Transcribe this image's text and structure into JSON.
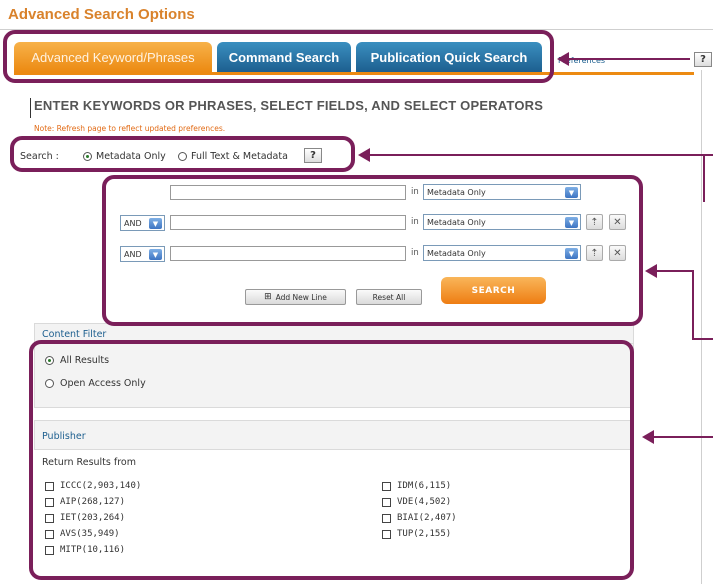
{
  "page": {
    "title": "Advanced Search Options"
  },
  "tabs": [
    {
      "label": "Advanced Keyword/Phrases",
      "active": true
    },
    {
      "label": "Command Search",
      "active": false
    },
    {
      "label": "Publication Quick Search",
      "active": false
    }
  ],
  "preferences_label": "Preferences",
  "help_label": "?",
  "heading": "ENTER KEYWORDS OR PHRASES, SELECT FIELDS, AND SELECT OPERATORS",
  "note": "Note: Refresh page to reflect updated preferences.",
  "search_scope": {
    "label": "Search :",
    "options": [
      {
        "label": "Metadata Only",
        "selected": true
      },
      {
        "label": "Full Text & Metadata",
        "selected": false
      }
    ]
  },
  "rows": [
    {
      "operator": "",
      "value": "",
      "in_label": "in",
      "field": "Metadata Only"
    },
    {
      "operator": "AND",
      "value": "",
      "in_label": "in",
      "field": "Metadata Only"
    },
    {
      "operator": "AND",
      "value": "",
      "in_label": "in",
      "field": "Metadata Only"
    }
  ],
  "buttons": {
    "add_new_line": "Add New Line",
    "reset_all": "Reset All",
    "search": "SEARCH"
  },
  "content_filter": {
    "title": "Content Filter",
    "options": [
      {
        "label": "All Results",
        "selected": true
      },
      {
        "label": "Open Access Only",
        "selected": false
      }
    ]
  },
  "publisher": {
    "title": "Publisher",
    "subtitle": "Return Results from",
    "left": [
      "ICCC(2,903,140)",
      "AIP(268,127)",
      "IET(203,264)",
      "AVS(35,949)",
      "MITP(10,116)"
    ],
    "right": [
      "IDM(6,115)",
      "VDE(4,502)",
      "BIAI(2,407)",
      "TUP(2,155)"
    ]
  },
  "colors": {
    "accent_orange": "#ec8a12",
    "tab_blue": "#1d5f8f",
    "callout": "#7a1f5a"
  }
}
